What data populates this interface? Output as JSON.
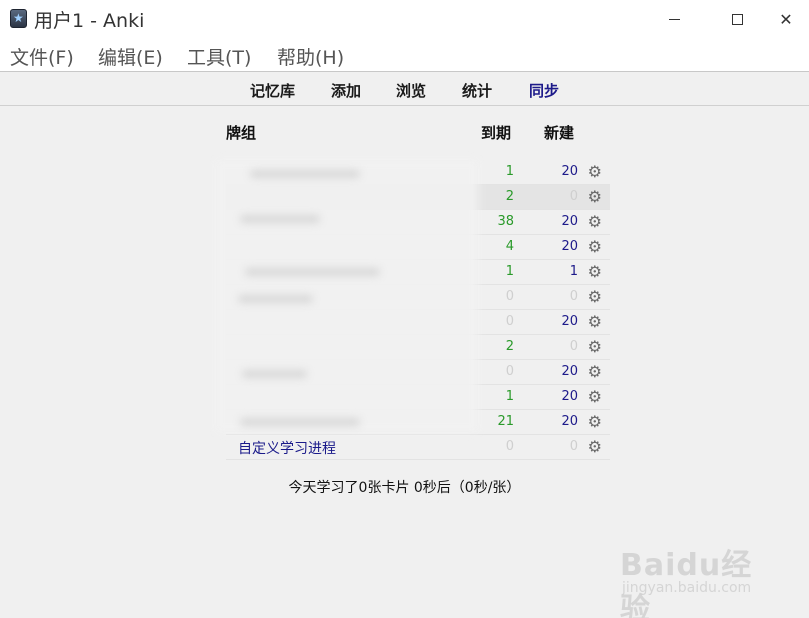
{
  "window": {
    "title": "用户1 - Anki",
    "minimize": "—",
    "maximize": "☐",
    "close": "✕"
  },
  "menu": {
    "file": "文件(F)",
    "edit": "编辑(E)",
    "tools": "工具(T)",
    "help": "帮助(H)"
  },
  "toolbar": {
    "decks": "记忆库",
    "add": "添加",
    "browse": "浏览",
    "stats": "统计",
    "sync": "同步"
  },
  "table": {
    "col_deck": "牌组",
    "col_due": "到期",
    "col_new": "新建",
    "rows": [
      {
        "name": "",
        "due": "1",
        "new": "20"
      },
      {
        "name": "",
        "due": "2",
        "new": "0"
      },
      {
        "name": "",
        "due": "38",
        "new": "20"
      },
      {
        "name": "",
        "due": "4",
        "new": "20"
      },
      {
        "name": "",
        "due": "1",
        "new": "1"
      },
      {
        "name": "",
        "due": "0",
        "new": "0"
      },
      {
        "name": "",
        "due": "0",
        "new": "20"
      },
      {
        "name": "",
        "due": "2",
        "new": "0"
      },
      {
        "name": "",
        "due": "0",
        "new": "20"
      },
      {
        "name": "",
        "due": "1",
        "new": "20"
      },
      {
        "name": "",
        "due": "21",
        "new": "20"
      },
      {
        "name": "自定义学习进程",
        "due": "0",
        "new": "0"
      }
    ]
  },
  "summary": "今天学习了0张卡片 0秒后（0秒/张）",
  "watermark": {
    "logo": "Baidu经验",
    "url": "jingyan.baidu.com"
  },
  "icons": {
    "gear": "⚙"
  }
}
